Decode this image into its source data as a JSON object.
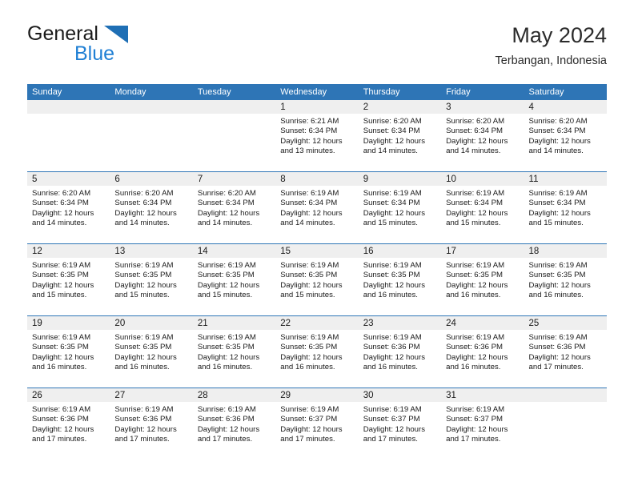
{
  "brand": {
    "name_part1": "General",
    "name_part2": "Blue",
    "triangle_color": "#1f6fb5",
    "blue_color": "#1f7fd4"
  },
  "header": {
    "title": "May 2024",
    "subtitle": "Terbangan, Indonesia"
  },
  "theme": {
    "header_bg": "#2e75b6",
    "day_number_bg": "#efefef",
    "text_color": "#1a1a1a"
  },
  "weekdays": [
    "Sunday",
    "Monday",
    "Tuesday",
    "Wednesday",
    "Thursday",
    "Friday",
    "Saturday"
  ],
  "weeks": [
    [
      {
        "day": "",
        "empty": true
      },
      {
        "day": "",
        "empty": true
      },
      {
        "day": "",
        "empty": true
      },
      {
        "day": "1",
        "sunrise": "Sunrise: 6:21 AM",
        "sunset": "Sunset: 6:34 PM",
        "daylight1": "Daylight: 12 hours",
        "daylight2": "and 13 minutes."
      },
      {
        "day": "2",
        "sunrise": "Sunrise: 6:20 AM",
        "sunset": "Sunset: 6:34 PM",
        "daylight1": "Daylight: 12 hours",
        "daylight2": "and 14 minutes."
      },
      {
        "day": "3",
        "sunrise": "Sunrise: 6:20 AM",
        "sunset": "Sunset: 6:34 PM",
        "daylight1": "Daylight: 12 hours",
        "daylight2": "and 14 minutes."
      },
      {
        "day": "4",
        "sunrise": "Sunrise: 6:20 AM",
        "sunset": "Sunset: 6:34 PM",
        "daylight1": "Daylight: 12 hours",
        "daylight2": "and 14 minutes."
      }
    ],
    [
      {
        "day": "5",
        "sunrise": "Sunrise: 6:20 AM",
        "sunset": "Sunset: 6:34 PM",
        "daylight1": "Daylight: 12 hours",
        "daylight2": "and 14 minutes."
      },
      {
        "day": "6",
        "sunrise": "Sunrise: 6:20 AM",
        "sunset": "Sunset: 6:34 PM",
        "daylight1": "Daylight: 12 hours",
        "daylight2": "and 14 minutes."
      },
      {
        "day": "7",
        "sunrise": "Sunrise: 6:20 AM",
        "sunset": "Sunset: 6:34 PM",
        "daylight1": "Daylight: 12 hours",
        "daylight2": "and 14 minutes."
      },
      {
        "day": "8",
        "sunrise": "Sunrise: 6:19 AM",
        "sunset": "Sunset: 6:34 PM",
        "daylight1": "Daylight: 12 hours",
        "daylight2": "and 14 minutes."
      },
      {
        "day": "9",
        "sunrise": "Sunrise: 6:19 AM",
        "sunset": "Sunset: 6:34 PM",
        "daylight1": "Daylight: 12 hours",
        "daylight2": "and 15 minutes."
      },
      {
        "day": "10",
        "sunrise": "Sunrise: 6:19 AM",
        "sunset": "Sunset: 6:34 PM",
        "daylight1": "Daylight: 12 hours",
        "daylight2": "and 15 minutes."
      },
      {
        "day": "11",
        "sunrise": "Sunrise: 6:19 AM",
        "sunset": "Sunset: 6:34 PM",
        "daylight1": "Daylight: 12 hours",
        "daylight2": "and 15 minutes."
      }
    ],
    [
      {
        "day": "12",
        "sunrise": "Sunrise: 6:19 AM",
        "sunset": "Sunset: 6:35 PM",
        "daylight1": "Daylight: 12 hours",
        "daylight2": "and 15 minutes."
      },
      {
        "day": "13",
        "sunrise": "Sunrise: 6:19 AM",
        "sunset": "Sunset: 6:35 PM",
        "daylight1": "Daylight: 12 hours",
        "daylight2": "and 15 minutes."
      },
      {
        "day": "14",
        "sunrise": "Sunrise: 6:19 AM",
        "sunset": "Sunset: 6:35 PM",
        "daylight1": "Daylight: 12 hours",
        "daylight2": "and 15 minutes."
      },
      {
        "day": "15",
        "sunrise": "Sunrise: 6:19 AM",
        "sunset": "Sunset: 6:35 PM",
        "daylight1": "Daylight: 12 hours",
        "daylight2": "and 15 minutes."
      },
      {
        "day": "16",
        "sunrise": "Sunrise: 6:19 AM",
        "sunset": "Sunset: 6:35 PM",
        "daylight1": "Daylight: 12 hours",
        "daylight2": "and 16 minutes."
      },
      {
        "day": "17",
        "sunrise": "Sunrise: 6:19 AM",
        "sunset": "Sunset: 6:35 PM",
        "daylight1": "Daylight: 12 hours",
        "daylight2": "and 16 minutes."
      },
      {
        "day": "18",
        "sunrise": "Sunrise: 6:19 AM",
        "sunset": "Sunset: 6:35 PM",
        "daylight1": "Daylight: 12 hours",
        "daylight2": "and 16 minutes."
      }
    ],
    [
      {
        "day": "19",
        "sunrise": "Sunrise: 6:19 AM",
        "sunset": "Sunset: 6:35 PM",
        "daylight1": "Daylight: 12 hours",
        "daylight2": "and 16 minutes."
      },
      {
        "day": "20",
        "sunrise": "Sunrise: 6:19 AM",
        "sunset": "Sunset: 6:35 PM",
        "daylight1": "Daylight: 12 hours",
        "daylight2": "and 16 minutes."
      },
      {
        "day": "21",
        "sunrise": "Sunrise: 6:19 AM",
        "sunset": "Sunset: 6:35 PM",
        "daylight1": "Daylight: 12 hours",
        "daylight2": "and 16 minutes."
      },
      {
        "day": "22",
        "sunrise": "Sunrise: 6:19 AM",
        "sunset": "Sunset: 6:35 PM",
        "daylight1": "Daylight: 12 hours",
        "daylight2": "and 16 minutes."
      },
      {
        "day": "23",
        "sunrise": "Sunrise: 6:19 AM",
        "sunset": "Sunset: 6:36 PM",
        "daylight1": "Daylight: 12 hours",
        "daylight2": "and 16 minutes."
      },
      {
        "day": "24",
        "sunrise": "Sunrise: 6:19 AM",
        "sunset": "Sunset: 6:36 PM",
        "daylight1": "Daylight: 12 hours",
        "daylight2": "and 16 minutes."
      },
      {
        "day": "25",
        "sunrise": "Sunrise: 6:19 AM",
        "sunset": "Sunset: 6:36 PM",
        "daylight1": "Daylight: 12 hours",
        "daylight2": "and 17 minutes."
      }
    ],
    [
      {
        "day": "26",
        "sunrise": "Sunrise: 6:19 AM",
        "sunset": "Sunset: 6:36 PM",
        "daylight1": "Daylight: 12 hours",
        "daylight2": "and 17 minutes."
      },
      {
        "day": "27",
        "sunrise": "Sunrise: 6:19 AM",
        "sunset": "Sunset: 6:36 PM",
        "daylight1": "Daylight: 12 hours",
        "daylight2": "and 17 minutes."
      },
      {
        "day": "28",
        "sunrise": "Sunrise: 6:19 AM",
        "sunset": "Sunset: 6:36 PM",
        "daylight1": "Daylight: 12 hours",
        "daylight2": "and 17 minutes."
      },
      {
        "day": "29",
        "sunrise": "Sunrise: 6:19 AM",
        "sunset": "Sunset: 6:37 PM",
        "daylight1": "Daylight: 12 hours",
        "daylight2": "and 17 minutes."
      },
      {
        "day": "30",
        "sunrise": "Sunrise: 6:19 AM",
        "sunset": "Sunset: 6:37 PM",
        "daylight1": "Daylight: 12 hours",
        "daylight2": "and 17 minutes."
      },
      {
        "day": "31",
        "sunrise": "Sunrise: 6:19 AM",
        "sunset": "Sunset: 6:37 PM",
        "daylight1": "Daylight: 12 hours",
        "daylight2": "and 17 minutes."
      },
      {
        "day": "",
        "empty": true
      }
    ]
  ]
}
